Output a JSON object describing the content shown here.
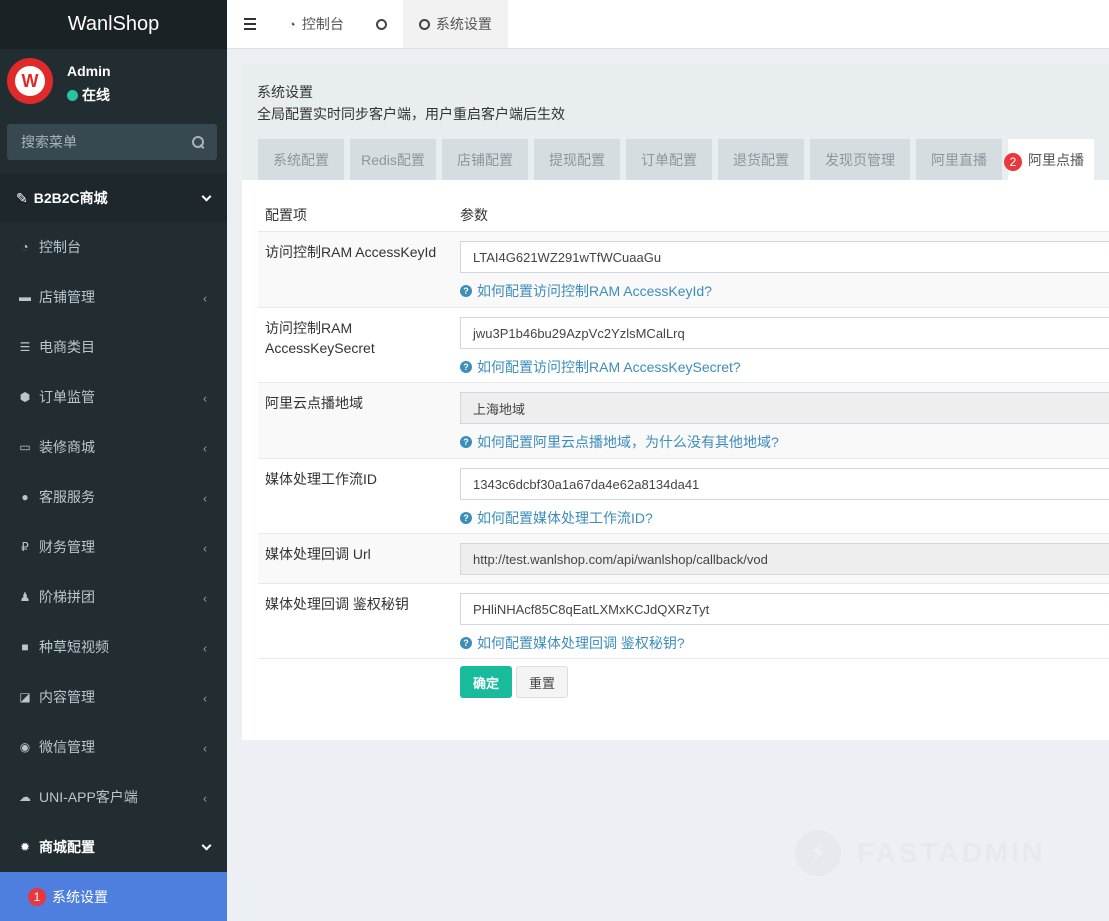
{
  "sidebar": {
    "brand": "WanlShop",
    "user": {
      "name": "Admin",
      "status": "在线"
    },
    "search_placeholder": "搜索菜单",
    "section": "B2B2C商城",
    "items": [
      {
        "label": "控制台",
        "icon": "dashboard-icon",
        "glyph": "◔",
        "has_arrow": false
      },
      {
        "label": "店铺管理",
        "icon": "store-icon",
        "glyph": "▬",
        "has_arrow": true
      },
      {
        "label": "电商类目",
        "icon": "list-icon",
        "glyph": "☰",
        "has_arrow": false
      },
      {
        "label": "订单监管",
        "icon": "cube-icon",
        "glyph": "⬢",
        "has_arrow": true
      },
      {
        "label": "装修商城",
        "icon": "desktop-icon",
        "glyph": "▭",
        "has_arrow": true
      },
      {
        "label": "客服服务",
        "icon": "comments-icon",
        "glyph": "●",
        "has_arrow": true
      },
      {
        "label": "财务管理",
        "icon": "ruble-icon",
        "glyph": "₽",
        "has_arrow": true
      },
      {
        "label": "阶梯拼团",
        "icon": "users-icon",
        "glyph": "♟",
        "has_arrow": true
      },
      {
        "label": "种草短视频",
        "icon": "video-icon",
        "glyph": "■",
        "has_arrow": true
      },
      {
        "label": "内容管理",
        "icon": "edit-icon",
        "glyph": "◪",
        "has_arrow": true
      },
      {
        "label": "微信管理",
        "icon": "wechat-icon",
        "glyph": "◉",
        "has_arrow": true
      },
      {
        "label": "UNI-APP客户端",
        "icon": "cloud-icon",
        "glyph": "☁",
        "has_arrow": true
      }
    ],
    "config_group": "商城配置",
    "active_item": {
      "label": "系统设置",
      "badge": "1"
    }
  },
  "topnav": {
    "tabs": [
      {
        "label": "控制台"
      },
      {
        "label": ""
      },
      {
        "label": "系统设置"
      }
    ]
  },
  "panel": {
    "title": "系统设置",
    "subtitle": "全局配置实时同步客户端，用户重启客户端后生效",
    "tabs": [
      "系统配置",
      "Redis配置",
      "店铺配置",
      "提现配置",
      "订单配置",
      "退货配置",
      "发现页管理",
      "阿里直播",
      "阿里点播"
    ],
    "active_tab_badge": "2",
    "header": {
      "col_item": "配置项",
      "col_param": "参数"
    },
    "rows": [
      {
        "label": "访问控制RAM AccessKeyId",
        "value": "LTAI4G621WZ291wTfWCuaaGu",
        "help": "如何配置访问控制RAM AccessKeyId?"
      },
      {
        "label": "访问控制RAM AccessKeySecret",
        "value": "jwu3P1b46bu29AzpVc2YzlsMCalLrq",
        "help": "如何配置访问控制RAM AccessKeySecret?"
      },
      {
        "label": "阿里云点播地域",
        "value": "上海地域",
        "help": "如何配置阿里云点播地域，为什么没有其他地域?"
      },
      {
        "label": "媒体处理工作流ID",
        "value": "1343c6dcbf30a1a67da4e62a8134da41",
        "help": "如何配置媒体处理工作流ID?"
      },
      {
        "label": "媒体处理回调 Url",
        "value": "http://test.wanlshop.com/api/wanlshop/callback/vod",
        "help": ""
      },
      {
        "label": "媒体处理回调 鉴权秘钥",
        "value": "PHliNHAcf85C8qEatLXMxKCJdQXRzTyt",
        "help": "如何配置媒体处理回调 鉴权秘钥?"
      }
    ],
    "buttons": {
      "confirm": "确定",
      "reset": "重置"
    }
  },
  "watermark": "FASTADMIN",
  "colors": {
    "accent": "#4e7ede",
    "primary": "#18bc9c",
    "link": "#3c8dbc",
    "sidebar": "#222d32"
  }
}
